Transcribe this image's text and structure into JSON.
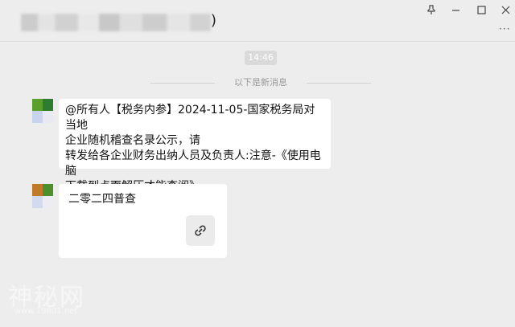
{
  "titlebar": {
    "title_suffix": ")",
    "controls": [
      "pin-icon",
      "minimize-icon",
      "maximize-icon",
      "close-icon"
    ],
    "more_label": "···"
  },
  "chat": {
    "timestamp": "14:46",
    "new_messages_label": "以下是新消息",
    "messages": [
      {
        "lines": [
          "@所有人【税务内参】2024-11-05-国家税务局对当地",
          "企业随机稽查名录公示，请",
          "转发给各企业财务出纳人员及负责人:注意-《使用电脑",
          "下载到点面解压才能查阅》"
        ]
      },
      {
        "card_title": "二零二四普查",
        "card_icon": "link-icon"
      }
    ]
  },
  "watermark": {
    "text": "神秘网",
    "subtext": "www.19801.net"
  },
  "colors": {
    "background": "#ededed",
    "bubble": "#ffffff",
    "avatar1": [
      "#5aa02c",
      "#2e7d2e",
      "#c8d3ee",
      "#e9e9f2"
    ],
    "avatar2": [
      "#c07a2a",
      "#4d8f2d",
      "#d2dbee",
      "#ececf3"
    ]
  }
}
